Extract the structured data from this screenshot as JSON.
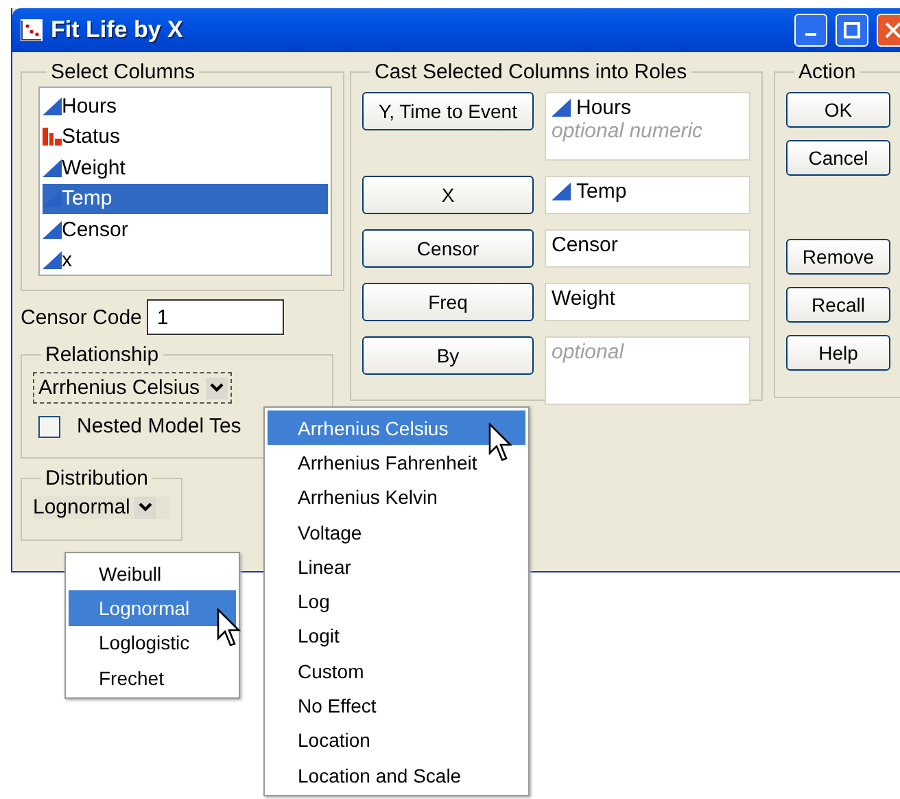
{
  "window": {
    "title": "Fit Life by X"
  },
  "select_columns": {
    "title": "Select Columns",
    "columns": [
      {
        "name": "Hours",
        "kind": "continuous",
        "selected": false
      },
      {
        "name": "Status",
        "kind": "nominal",
        "selected": false
      },
      {
        "name": "Weight",
        "kind": "continuous",
        "selected": false
      },
      {
        "name": "Temp",
        "kind": "continuous",
        "selected": true
      },
      {
        "name": "Censor",
        "kind": "continuous",
        "selected": false
      },
      {
        "name": "x",
        "kind": "continuous",
        "selected": false
      }
    ]
  },
  "censor_code": {
    "label": "Censor Code",
    "value": "1"
  },
  "relationship": {
    "title": "Relationship",
    "value": "Arrhenius Celsius",
    "nested_model_test": {
      "label": "Nested Model Tes",
      "checked": false
    }
  },
  "distribution": {
    "title": "Distribution",
    "value": "Lognormal"
  },
  "roles": {
    "title": "Cast Selected Columns into Roles",
    "rows": [
      {
        "button": "Y, Time to Event",
        "entries": [
          {
            "text": "Hours",
            "kind": "column"
          },
          {
            "text": "optional numeric",
            "kind": "placeholder"
          }
        ]
      },
      {
        "button": "X",
        "entries": [
          {
            "text": "Temp",
            "kind": "column"
          }
        ]
      },
      {
        "button": "Censor",
        "entries": [
          {
            "text": "Censor",
            "kind": "text"
          }
        ]
      },
      {
        "button": "Freq",
        "entries": [
          {
            "text": "Weight",
            "kind": "text"
          }
        ]
      },
      {
        "button": "By",
        "entries": [
          {
            "text": "optional",
            "kind": "placeholder"
          }
        ]
      }
    ]
  },
  "action": {
    "title": "Action",
    "buttons_top": [
      "OK",
      "Cancel"
    ],
    "buttons_bottom": [
      "Remove",
      "Recall",
      "Help"
    ]
  },
  "relationship_menu": {
    "items": [
      {
        "label": "Arrhenius Celsius",
        "selected": true
      },
      {
        "label": "Arrhenius Fahrenheit",
        "selected": false
      },
      {
        "label": "Arrhenius Kelvin",
        "selected": false
      },
      {
        "label": "Voltage",
        "selected": false
      },
      {
        "label": "Linear",
        "selected": false
      },
      {
        "label": "Log",
        "selected": false
      },
      {
        "label": "Logit",
        "selected": false
      },
      {
        "label": "Custom",
        "selected": false
      },
      {
        "label": "No Effect",
        "selected": false
      },
      {
        "label": "Location",
        "selected": false
      },
      {
        "label": "Location and Scale",
        "selected": false
      }
    ]
  },
  "distribution_menu": {
    "items": [
      {
        "label": "Weibull",
        "selected": false
      },
      {
        "label": "Lognormal",
        "selected": true
      },
      {
        "label": "Loglogistic",
        "selected": false
      },
      {
        "label": "Frechet",
        "selected": false
      }
    ]
  }
}
